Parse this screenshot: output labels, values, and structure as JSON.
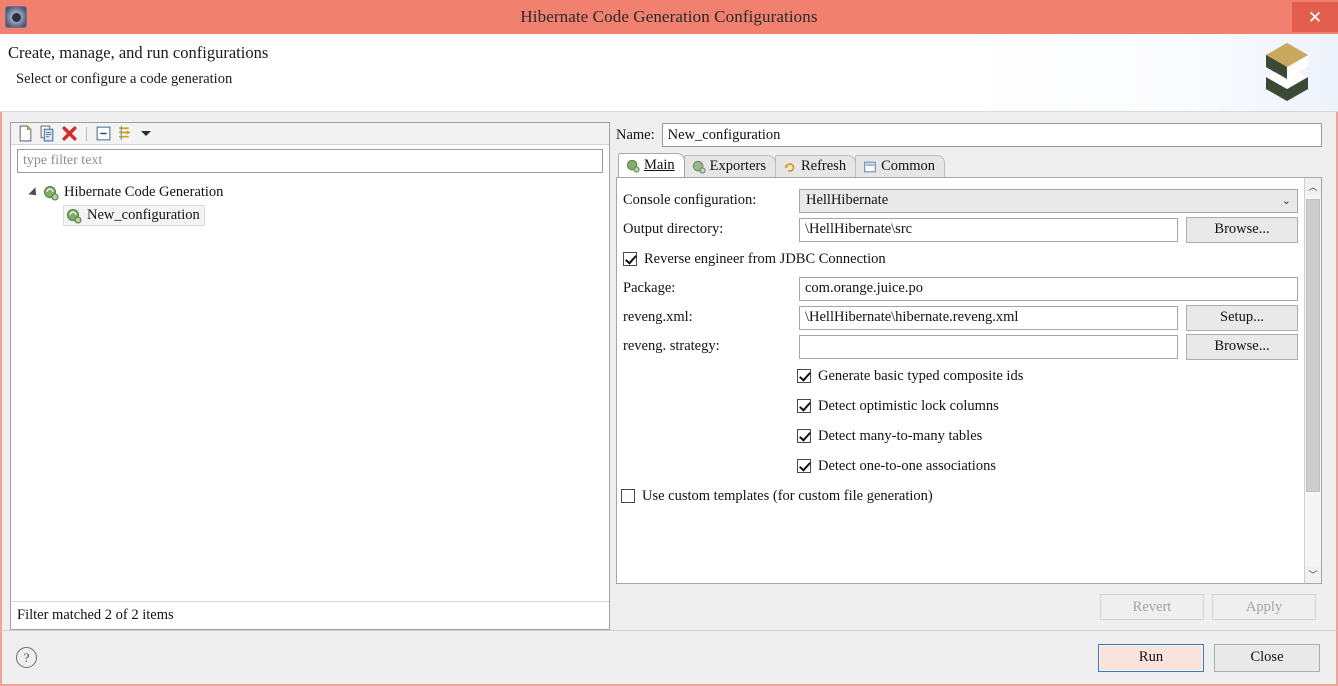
{
  "window": {
    "title": "Hibernate Code Generation Configurations",
    "icon": "gear-icon",
    "close_label": "✕"
  },
  "banner": {
    "title": "Create, manage, and run configurations",
    "subtitle": "Select or configure a code generation",
    "logo": "hibernate-logo"
  },
  "left_panel": {
    "toolbar": [
      {
        "name": "new-configuration-icon",
        "title": "New"
      },
      {
        "name": "duplicate-configuration-icon",
        "title": "Duplicate"
      },
      {
        "name": "delete-configuration-icon",
        "title": "Delete"
      },
      {
        "name": "collapse-all-icon",
        "title": "Collapse All"
      },
      {
        "name": "filter-configurations-icon",
        "title": "Filter"
      },
      {
        "name": "chevron-down-icon",
        "title": "View Menu"
      }
    ],
    "filter_placeholder": "type filter text",
    "filter_value": "",
    "tree": [
      {
        "label": "Hibernate Code Generation",
        "level": 0,
        "expanded": true,
        "selected": false
      },
      {
        "label": "New_configuration",
        "level": 1,
        "expanded": false,
        "selected": true
      }
    ],
    "status": "Filter matched 2 of 2 items"
  },
  "right_panel": {
    "name_label": "Name:",
    "name_value": "New_configuration",
    "tabs": [
      {
        "label": "Main",
        "icon": "hibernate-icon",
        "active": true
      },
      {
        "label": "Exporters",
        "icon": "hibernate-icon",
        "active": false
      },
      {
        "label": "Refresh",
        "icon": "refresh-icon",
        "active": false
      },
      {
        "label": "Common",
        "icon": "common-icon",
        "active": false
      }
    ],
    "main_tab": {
      "console_configuration": {
        "label": "Console configuration:",
        "value": "HellHibernate"
      },
      "output_directory": {
        "label": "Output directory:",
        "value": "\\HellHibernate\\src",
        "button": "Browse..."
      },
      "reverse_engineer": {
        "label": "Reverse engineer from JDBC Connection",
        "checked": true
      },
      "package": {
        "label": "Package:",
        "value": "com.orange.juice.po"
      },
      "reveng_xml": {
        "label": "reveng.xml:",
        "value": "\\HellHibernate\\hibernate.reveng.xml",
        "button": "Setup..."
      },
      "reveng_strategy": {
        "label": "reveng. strategy:",
        "value": "",
        "button": "Browse..."
      },
      "options": [
        {
          "label": "Generate basic typed composite ids",
          "checked": true
        },
        {
          "label": "Detect optimistic lock columns",
          "checked": true
        },
        {
          "label": "Detect many-to-many tables",
          "checked": true
        },
        {
          "label": "Detect one-to-one associations",
          "checked": true
        }
      ],
      "custom_templates": {
        "label": "Use custom templates (for custom file generation)",
        "checked": false
      }
    },
    "revert_label": "Revert",
    "apply_label": "Apply"
  },
  "footer": {
    "help_label": "?",
    "run_label": "Run",
    "close_label": "Close"
  },
  "colors": {
    "titlebar": "#f2806f",
    "close_button": "#e25d4d",
    "frame_border": "#f0a294",
    "panel_bg": "#efefef",
    "focus_border": "#3a7cc0",
    "run_button_bg": "#fae3dd"
  }
}
